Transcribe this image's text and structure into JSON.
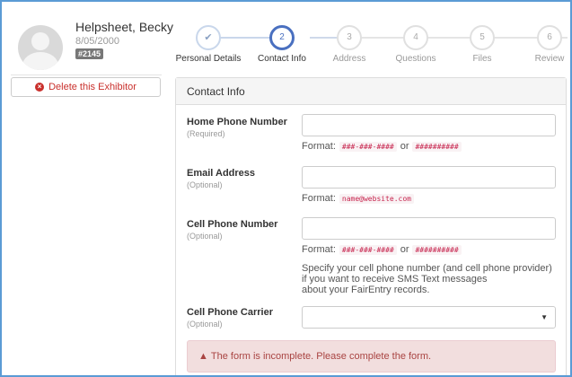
{
  "profile": {
    "name": "Helpsheet, Becky",
    "dob": "8/05/2000",
    "badge": "#2145",
    "delete_label": "Delete this Exhibitor"
  },
  "stepper": {
    "steps": [
      {
        "number": "✔",
        "label": "Personal Details",
        "state": "done"
      },
      {
        "number": "2",
        "label": "Contact Info",
        "state": "active"
      },
      {
        "number": "3",
        "label": "Address",
        "state": "todo"
      },
      {
        "number": "4",
        "label": "Questions",
        "state": "todo"
      },
      {
        "number": "5",
        "label": "Files",
        "state": "todo"
      },
      {
        "number": "6",
        "label": "Review",
        "state": "todo"
      }
    ]
  },
  "form": {
    "title": "Contact Info",
    "home_phone": {
      "label": "Home Phone Number",
      "sub": "(Required)",
      "value": "",
      "format_prefix": "Format:",
      "format_a": "###-###-####",
      "format_or": "or",
      "format_b": "##########"
    },
    "email": {
      "label": "Email Address",
      "sub": "(Optional)",
      "value": "",
      "format_prefix": "Format:",
      "format_a": "name@website.com"
    },
    "cell_phone": {
      "label": "Cell Phone Number",
      "sub": "(Optional)",
      "value": "",
      "format_prefix": "Format:",
      "format_a": "###-###-####",
      "format_or": "or",
      "format_b": "##########",
      "help_line1": "Specify your cell phone number (and cell phone provider)",
      "help_line2": "if you want to receive SMS Text messages",
      "help_line3": "about your FairEntry records."
    },
    "carrier": {
      "label": "Cell Phone Carrier",
      "sub": "(Optional)",
      "value": ""
    },
    "alert": "The form is incomplete. Please complete the form."
  },
  "colors": {
    "accent": "#4a70c0",
    "danger": "#c9302c",
    "alert_bg": "#f2dede",
    "alert_text": "#a94442",
    "code": "#c7254e"
  }
}
